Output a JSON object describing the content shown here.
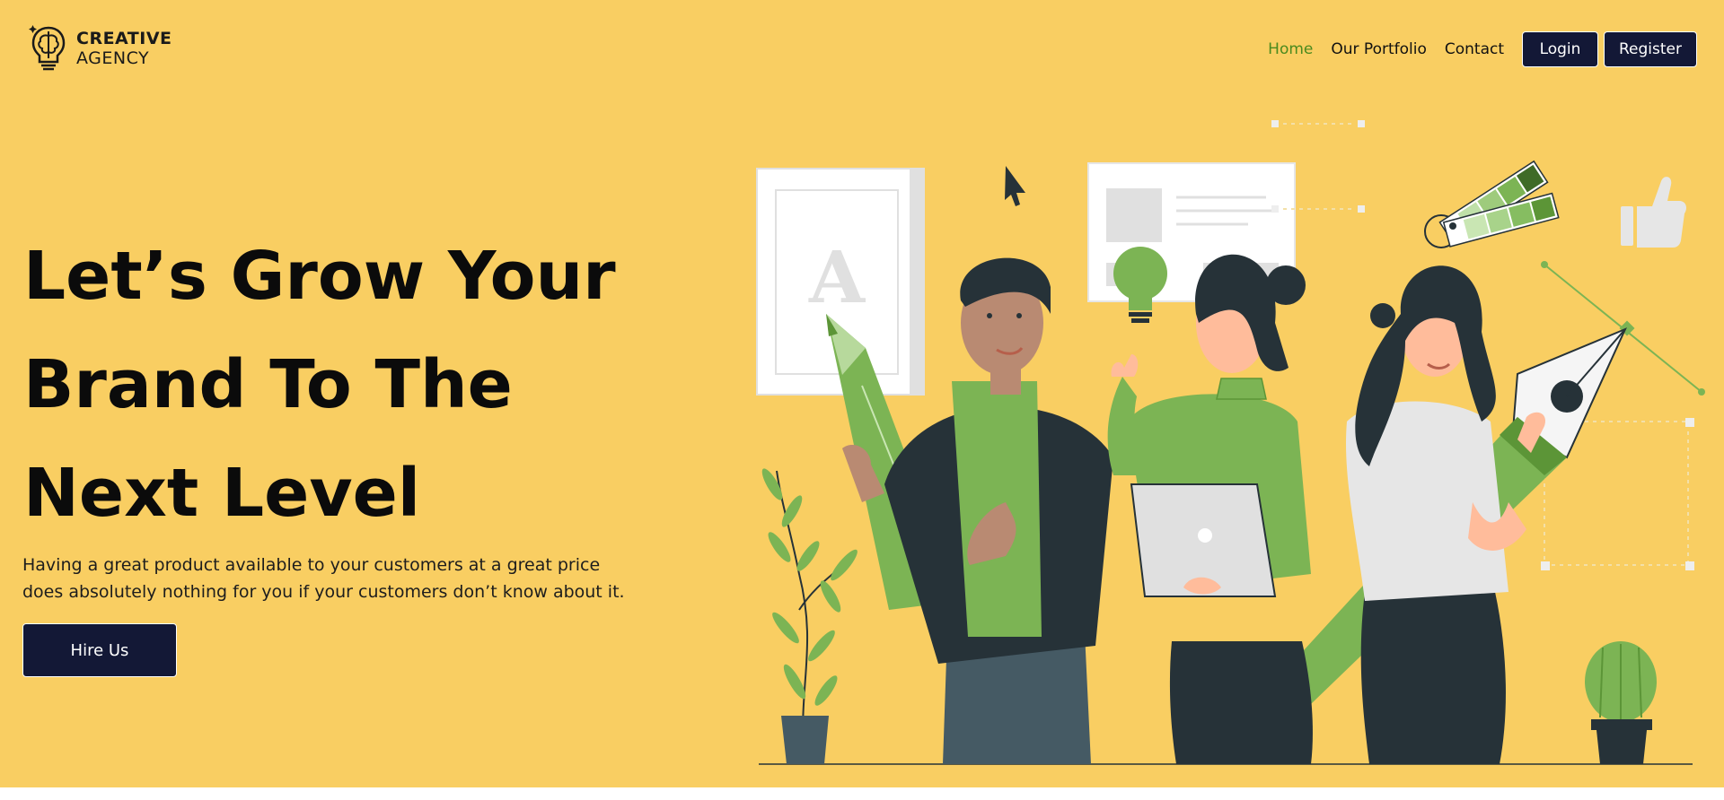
{
  "brand": {
    "line1": "CREATIVE",
    "line2": "AGENCY",
    "icon": "brain-lightbulb-icon"
  },
  "nav": {
    "links": [
      {
        "label": "Home",
        "active": true
      },
      {
        "label": "Our Portfolio",
        "active": false
      },
      {
        "label": "Contact",
        "active": false
      }
    ],
    "login_label": "Login",
    "register_label": "Register"
  },
  "hero": {
    "headline_lines": [
      "Let’s Grow Your",
      "Brand To The",
      "Next Level"
    ],
    "subtext": "Having a great product available to your customers at a great price does absolutely nothing for you if your customers don’t know about it.",
    "cta_label": "Hire Us",
    "illustration_letter": "A"
  },
  "colors": {
    "background": "#f9ce62",
    "accent_green": "#7cb454",
    "active_link": "#4b8a1e",
    "button_dark": "#131836",
    "dark_clothing": "#263238"
  }
}
